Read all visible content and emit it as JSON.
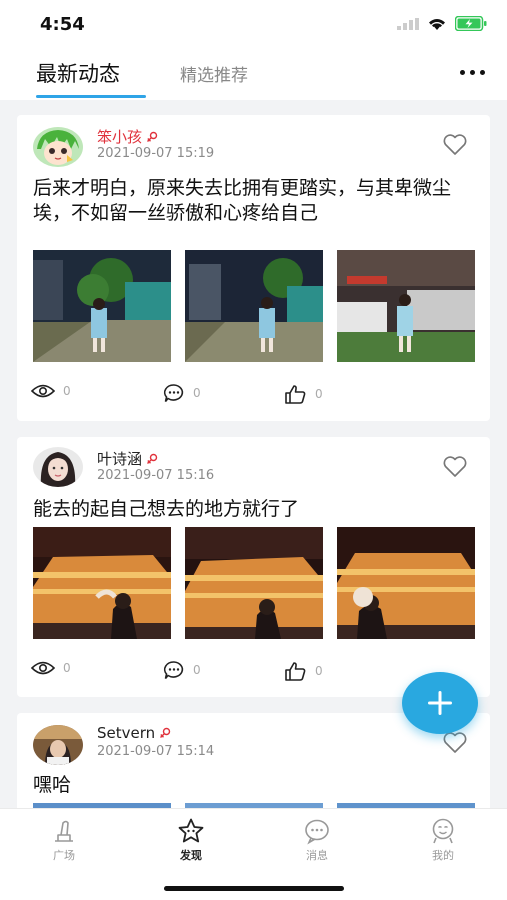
{
  "status_bar": {
    "time": "4:54"
  },
  "tabs": {
    "active": "最新动态",
    "inactive": "精选推荐"
  },
  "posts": [
    {
      "username": "笨小孩",
      "time": "2021-09-07 15:19",
      "text": "后来才明白，原来失去比拥有更踏实，与其卑微尘埃，不如留一丝骄傲和心疼给自己",
      "views": "0",
      "comments": "0",
      "likes": "0"
    },
    {
      "username": "叶诗涵",
      "time": "2021-09-07 15:16",
      "text": "能去的起自己想去的地方就行了",
      "views": "0",
      "comments": "0",
      "likes": "0"
    },
    {
      "username": "Setvern",
      "time": "2021-09-07 15:14",
      "text": "嘿哈"
    }
  ],
  "tabbar": [
    {
      "label": "广场"
    },
    {
      "label": "发现"
    },
    {
      "label": "消息"
    },
    {
      "label": "我的"
    }
  ],
  "colors": {
    "accent": "#2fa4e7",
    "username_red": "#e0323c",
    "female_icon": "#e0323c"
  }
}
